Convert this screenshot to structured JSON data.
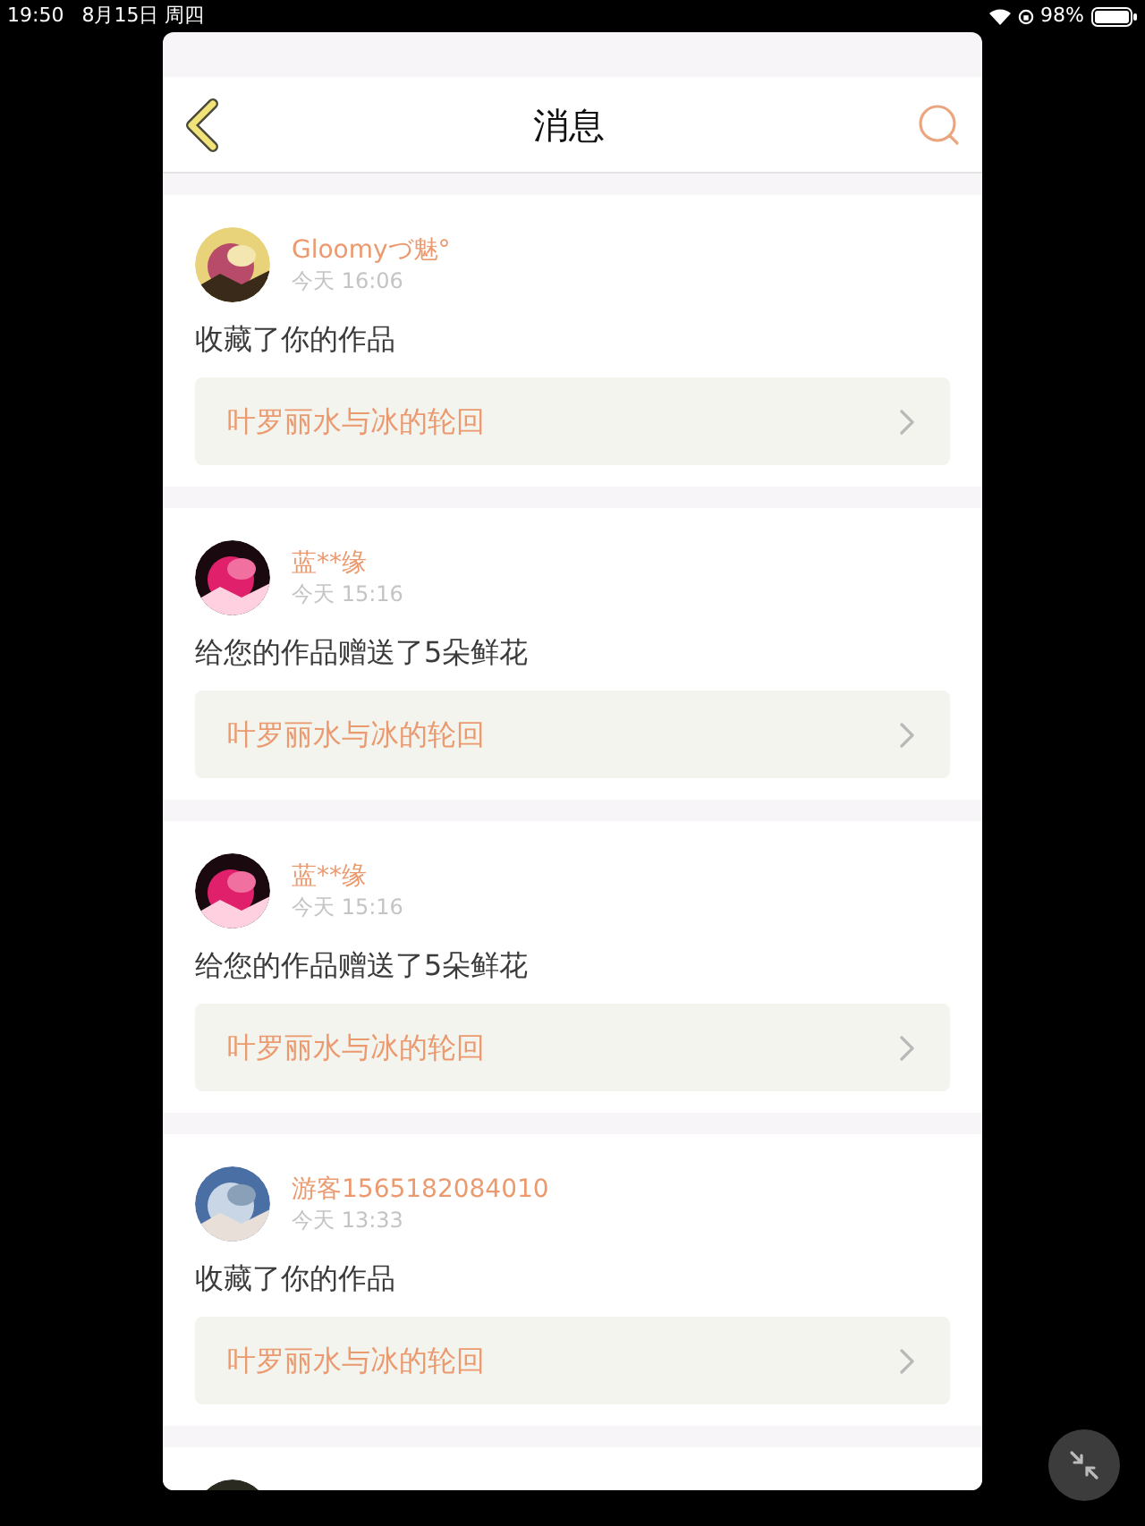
{
  "status_bar": {
    "time": "19:50",
    "date": "8月15日 周四",
    "battery": "98%"
  },
  "header": {
    "title": "消息"
  },
  "messages": [
    {
      "user": "Gloomyづ魅°",
      "time": "今天 16:06",
      "action": "收藏了你的作品",
      "work": "叶罗丽水与冰的轮回"
    },
    {
      "user": "蓝**缘",
      "time": "今天 15:16",
      "action": "给您的作品赠送了5朵鲜花",
      "work": "叶罗丽水与冰的轮回"
    },
    {
      "user": "蓝**缘",
      "time": "今天 15:16",
      "action": "给您的作品赠送了5朵鲜花",
      "work": "叶罗丽水与冰的轮回"
    },
    {
      "user": "游客1565182084010",
      "time": "今天 13:33",
      "action": "收藏了你的作品",
      "work": "叶罗丽水与冰的轮回"
    }
  ]
}
